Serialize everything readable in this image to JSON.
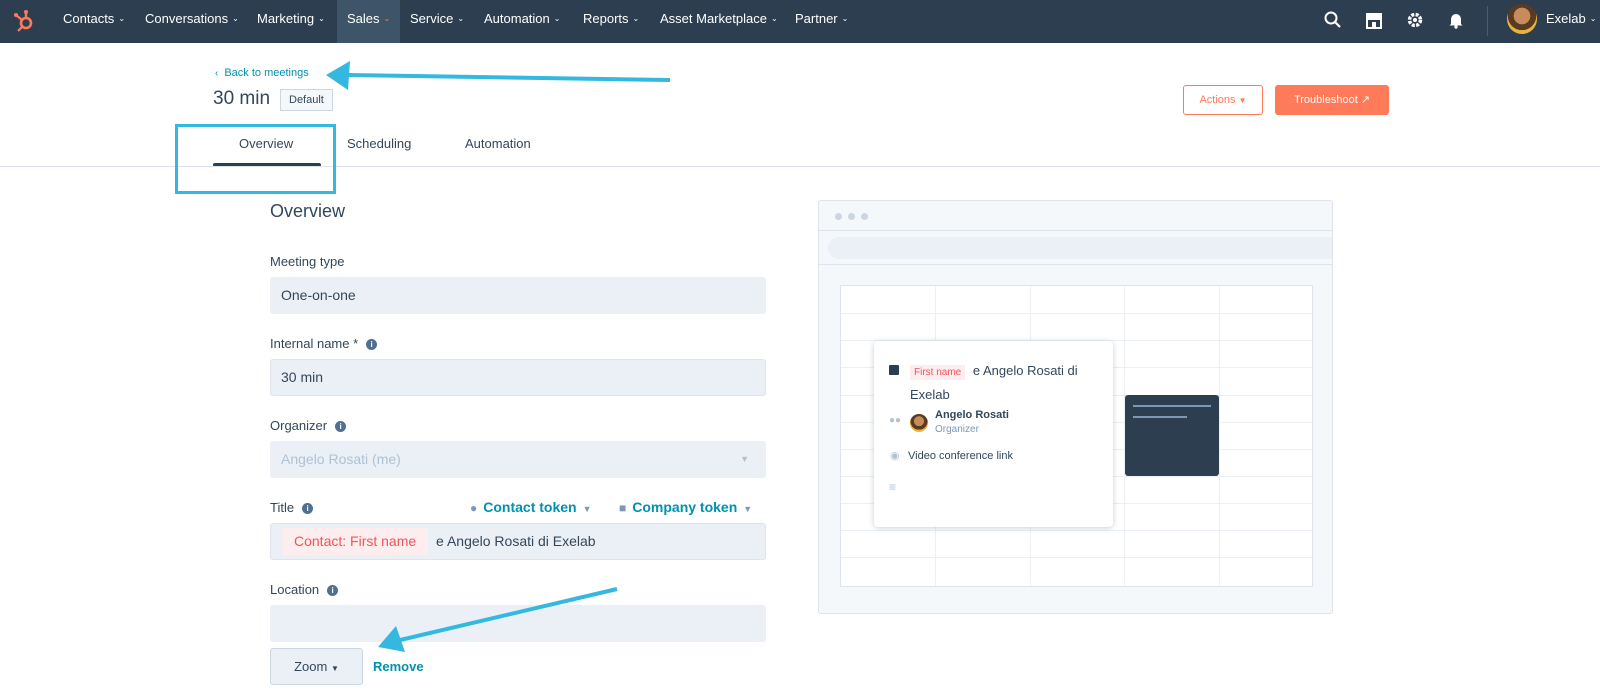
{
  "nav": {
    "items": [
      {
        "label": "Contacts"
      },
      {
        "label": "Conversations"
      },
      {
        "label": "Marketing"
      },
      {
        "label": "Sales"
      },
      {
        "label": "Service"
      },
      {
        "label": "Automation"
      },
      {
        "label": "Reports"
      },
      {
        "label": "Asset Marketplace"
      },
      {
        "label": "Partner"
      }
    ],
    "active": "Sales",
    "icons": [
      "search-icon",
      "marketplace-icon",
      "gear-icon",
      "bell-icon"
    ],
    "user": "Exelab"
  },
  "header": {
    "back_link": "Back to meetings",
    "title": "30 min",
    "tag": "Default",
    "actions_label": "Actions",
    "troubleshoot_label": "Troubleshoot"
  },
  "tabs": [
    {
      "label": "Overview"
    },
    {
      "label": "Scheduling"
    },
    {
      "label": "Automation"
    }
  ],
  "form": {
    "section_title": "Overview",
    "meeting_type_label": "Meeting type",
    "meeting_type_value": "One-on-one",
    "internal_name_label": "Internal name *",
    "internal_name_value": "30 min",
    "organizer_label": "Organizer",
    "organizer_value": "Angelo Rosati (me)",
    "title_label": "Title",
    "contact_token_label": "Contact token",
    "company_token_label": "Company token",
    "title_token": "Contact: First name",
    "title_text": "e Angelo Rosati di Exelab",
    "location_label": "Location",
    "location_value": "",
    "zoom_label": "Zoom",
    "remove_label": "Remove"
  },
  "preview": {
    "token": "First name",
    "title_text": "e Angelo Rosati di Exelab",
    "organizer_name": "Angelo Rosati",
    "organizer_role": "Organizer",
    "location_text": "Video conference link"
  },
  "colors": {
    "nav_bg": "#2d3e50",
    "accent_orange": "#ff7a59",
    "link_teal": "#0091ae",
    "annotation_blue": "#34b8e0",
    "token_red": "#f2545b"
  }
}
